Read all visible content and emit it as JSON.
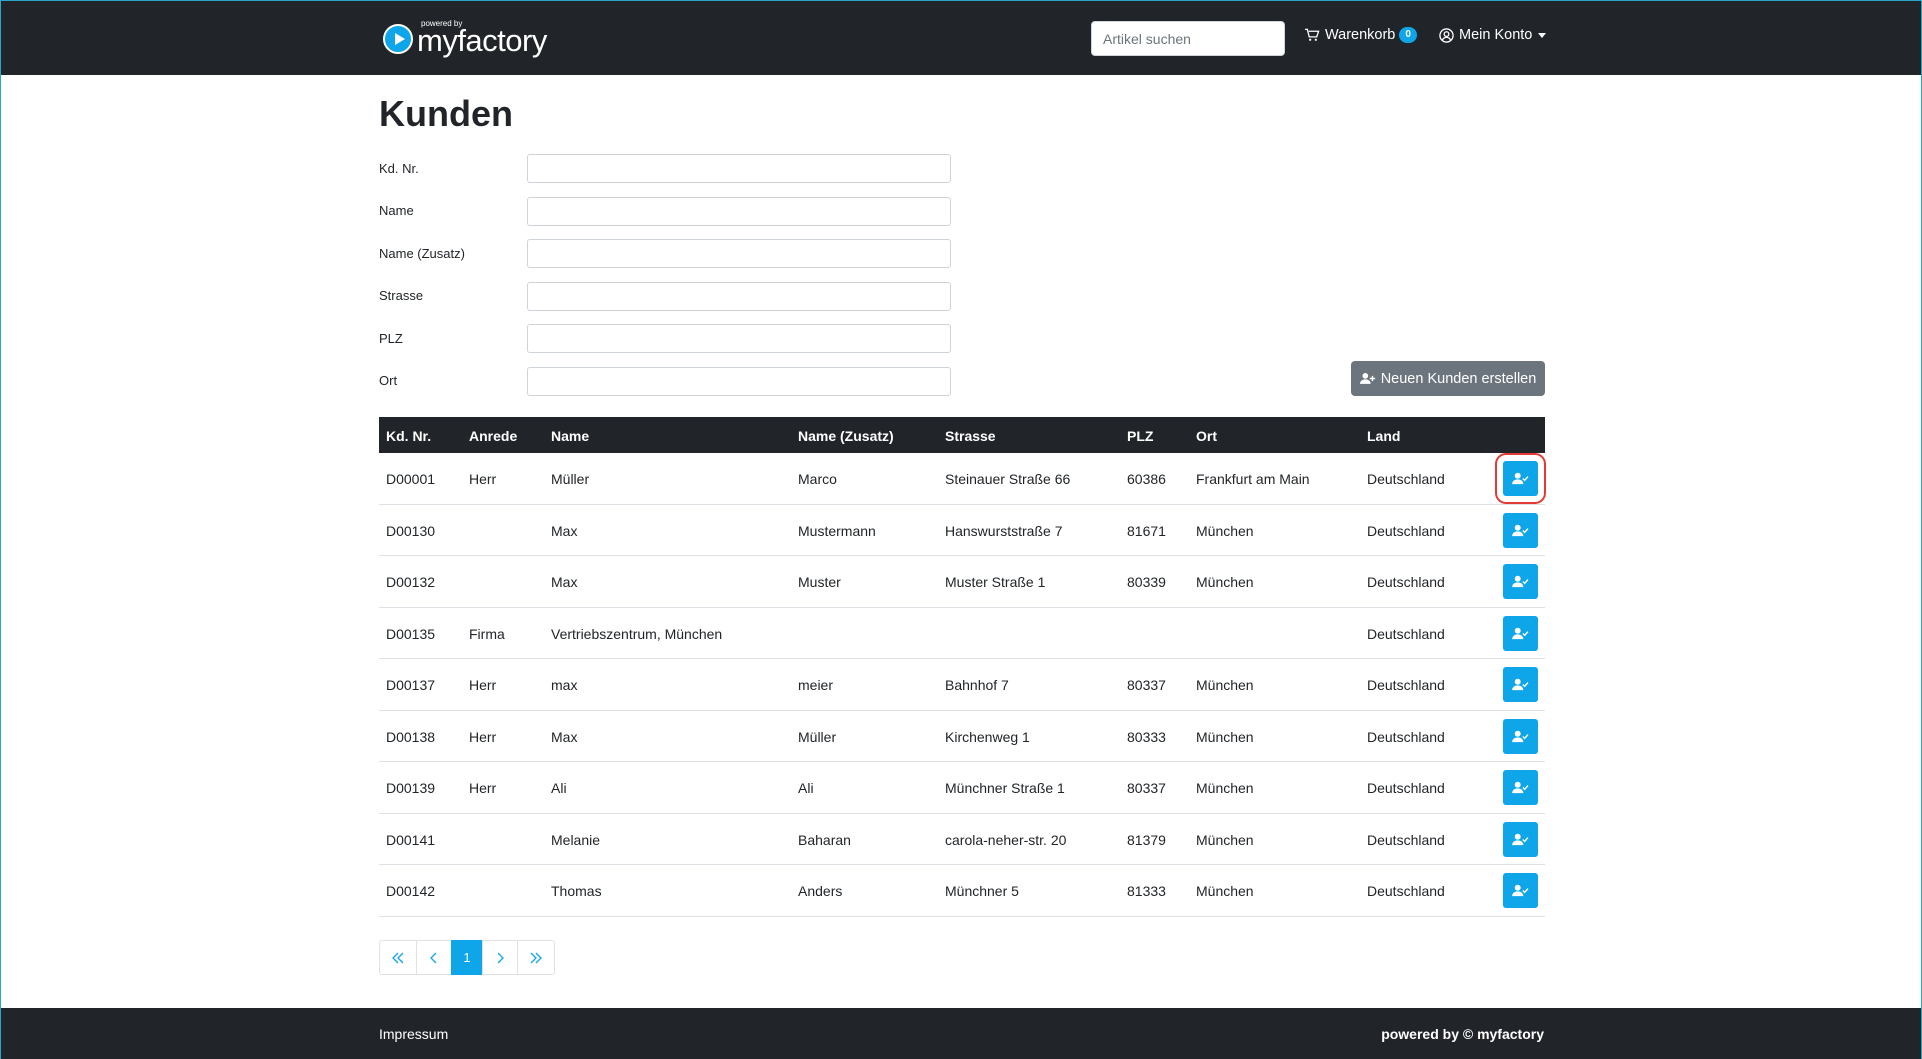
{
  "header": {
    "brand_powered": "powered by",
    "brand_name": "myfactory",
    "search_placeholder": "Artikel suchen",
    "cart_label": "Warenkorb",
    "cart_count": "0",
    "account_label": "Mein Konto"
  },
  "page": {
    "title": "Kunden",
    "new_customer_button": "Neuen Kunden erstellen"
  },
  "filters": [
    {
      "label": "Kd. Nr.",
      "value": ""
    },
    {
      "label": "Name",
      "value": ""
    },
    {
      "label": "Name (Zusatz)",
      "value": ""
    },
    {
      "label": "Strasse",
      "value": ""
    },
    {
      "label": "PLZ",
      "value": ""
    },
    {
      "label": "Ort",
      "value": ""
    }
  ],
  "table": {
    "headers": [
      "Kd. Nr.",
      "Anrede",
      "Name",
      "Name (Zusatz)",
      "Strasse",
      "PLZ",
      "Ort",
      "Land"
    ],
    "rows": [
      [
        "D00001",
        "Herr",
        "Müller",
        "Marco",
        "Steinauer Straße 66",
        "60386",
        "Frankfurt am Main",
        "Deutschland"
      ],
      [
        "D00130",
        "",
        "Max",
        "Mustermann",
        "Hanswurststraße 7",
        "81671",
        "München",
        "Deutschland"
      ],
      [
        "D00132",
        "",
        "Max",
        "Muster",
        "Muster Straße 1",
        "80339",
        "München",
        "Deutschland"
      ],
      [
        "D00135",
        "Firma",
        "Vertriebszentrum, München",
        "",
        "",
        "",
        "",
        "Deutschland"
      ],
      [
        "D00137",
        "Herr",
        "max",
        "meier",
        "Bahnhof 7",
        "80337",
        "München",
        "Deutschland"
      ],
      [
        "D00138",
        "Herr",
        "Max",
        "Müller",
        "Kirchenweg 1",
        "80333",
        "München",
        "Deutschland"
      ],
      [
        "D00139",
        "Herr",
        "Ali",
        "Ali",
        "Münchner Straße 1",
        "80337",
        "München",
        "Deutschland"
      ],
      [
        "D00141",
        "",
        "Melanie",
        "Baharan",
        "carola-neher-str. 20",
        "81379",
        "München",
        "Deutschland"
      ],
      [
        "D00142",
        "",
        "Thomas",
        "Anders",
        "Münchner 5",
        "81333",
        "München",
        "Deutschland"
      ]
    ]
  },
  "pagination": {
    "current_page": "1"
  },
  "footer": {
    "left": "Impressum",
    "right": "powered by © myfactory"
  },
  "colors": {
    "navbar": "#212529",
    "accent": "#0ea5e9",
    "secondary_button": "#6c757d",
    "highlight": "#e53935"
  }
}
